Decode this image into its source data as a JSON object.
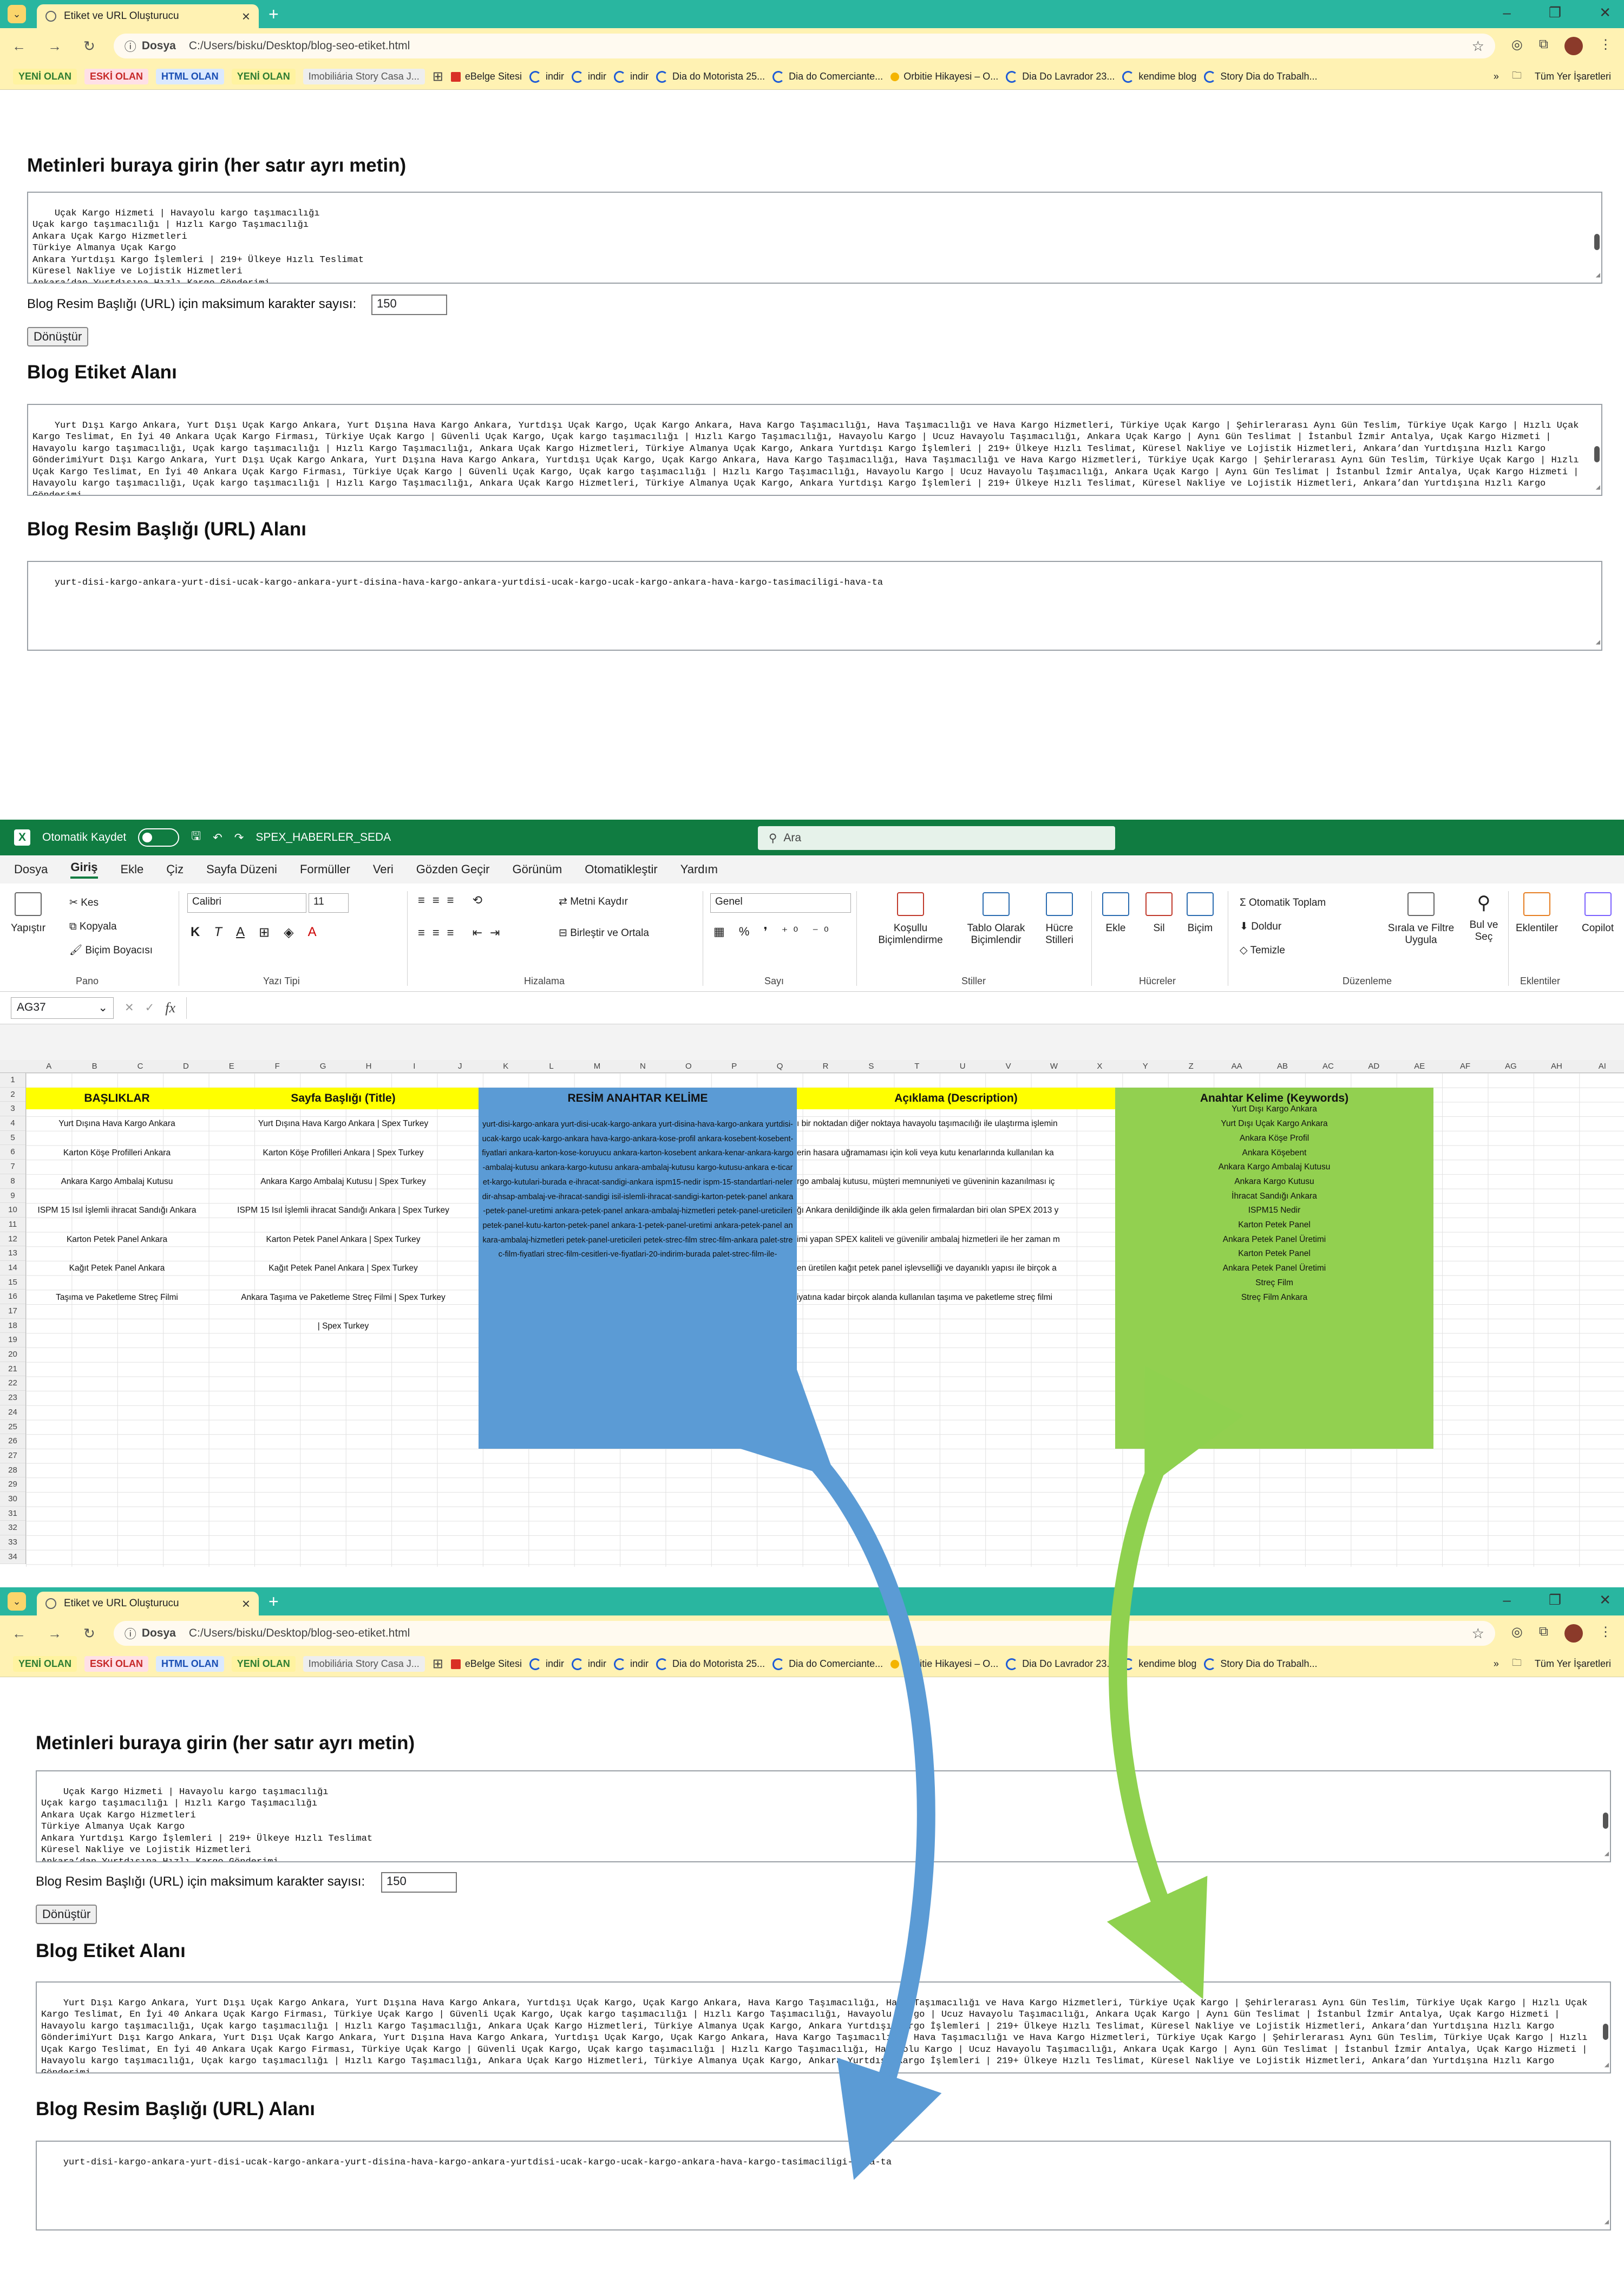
{
  "browser": {
    "tab_title": "Etiket ve URL Oluşturucu",
    "url_chip": "Dosya",
    "url": "C:/Users/bisku/Desktop/blog-seo-etiket.html",
    "bookmarks": [
      "YENİ OLAN",
      "ESKİ OLAN",
      "HTML OLAN",
      "YENİ OLAN",
      "Imobiliária Story Casa J..."
    ],
    "bookmarks_links": [
      "eBelge Sitesi",
      "indir",
      "indir",
      "indir",
      "Dia do Motorista 25...",
      "Dia do Comerciante...",
      "Orbitie Hikayesi – O...",
      "Dia Do Lavrador 23...",
      "kendime blog",
      "Story Dia do Trabalh..."
    ],
    "bookmarks_more": "»",
    "all_bookmarks": "Tüm Yer İşaretleri"
  },
  "tool": {
    "h_input": "Metinleri buraya girin (her satır ayrı metin)",
    "input_lines": "Uçak Kargo Hizmeti | Havayolu kargo taşımacılığı\nUçak kargo taşımacılığı | Hızlı Kargo Taşımacılığı\nAnkara Uçak Kargo Hizmetleri\nTürkiye Almanya Uçak Kargo\nAnkara Yurtdışı Kargo İşlemleri | 219+ Ülkeye Hızlı Teslimat\nKüresel Nakliye ve Lojistik Hizmetleri\nAnkara’dan Yurtdışına Hızlı Kargo Gönderimi",
    "max_label": "Blog Resim Başlığı (URL) için maksimum karakter sayısı:",
    "max_value": "150",
    "convert": "Dönüştür",
    "h_tags": "Blog Etiket Alanı",
    "tags_text_1": "Yurt Dışı Kargo Ankara, Yurt Dışı Uçak Kargo Ankara, Yurt Dışına Hava Kargo Ankara, Yurtdışı Uçak Kargo, Uçak Kargo Ankara, Hava Kargo Taşımacılığı, Hava Taşımacılığı ve Hava Kargo Hizmetleri, Türkiye Uçak Kargo | Şehirlerarası Aynı Gün Teslim, Türkiye Uçak Kargo | Hızlı Uçak Kargo Teslimat, En İyi 40 Ankara Uçak Kargo Firması, Türkiye Uçak Kargo | Güvenli Uçak Kargo, Uçak kargo taşımacılığı | Hızlı Kargo Taşımacılığı, Havayolu Kargo | Ucuz Havayolu Taşımacılığı, Ankara Uçak Kargo | Aynı Gün Teslimat | İstanbul İzmir Antalya, Uçak Kargo Hizmeti | Havayolu kargo taşımacılığı, Uçak kargo taşımacılığı | Hızlı Kargo Taşımacılığı, Ankara Uçak Kargo Hizmetleri, Türkiye Almanya Uçak Kargo, Ankara Yurtdışı Kargo İşlemleri | 219+ Ülkeye Hızlı Teslimat, Küresel Nakliye ve Lojistik Hizmetleri, Ankara’dan Yurtdışına Hızlı Kargo GönderimiYurt Dışı Kargo Ankara, Yurt Dışı Uçak Kargo Ankara, Yurt Dışına Hava Kargo Ankara, Yurtdışı Uçak Kargo, Uçak Kargo Ankara, Hava Kargo Taşımacılığı, Hava Taşımacılığı ve Hava Kargo Hizmetleri, Türkiye Uçak Kargo | Şehirlerarası Aynı Gün Teslim, Türkiye Uçak Kargo | Hızlı Uçak Kargo Teslimat, En İyi 40 Ankara Uçak Kargo Firması, Türkiye Uçak Kargo | Güvenli Uçak Kargo, Uçak kargo taşımacılığı | Hızlı Kargo Taşımacılığı, Havayolu Kargo | Ucuz Havayolu Taşımacılığı, Ankara Uçak Kargo | Aynı Gün Teslimat | İstanbul İzmir Antalya, Uçak Kargo Hizmeti | Havayolu kargo taşımacılığı, Uçak kargo taşımacılığı | Hızlı Kargo Taşımacılığı, Ankara Uçak Kargo Hizmetleri, Türkiye Almanya Uçak Kargo, Ankara Yurtdışı Kargo İşlemleri | 219+ Ülkeye Hızlı Teslimat, Küresel Nakliye ve Lojistik Hizmetleri, Ankara’dan Yurtdışına Hızlı Kargo Gönderimi.",
    "tags_text_2": "Yurt Dışı Kargo Ankara, Yurt Dışı Uçak Kargo Ankara, Yurt Dışına Hava Kargo Ankara, Yurtdışı Uçak Kargo, Uçak Kargo Ankara, Hava Kargo Taşımacılığı, Hava Taşımacılığı ve Hava Kargo Hizmetleri, Türkiye Uçak Kargo | Şehirlerarası Aynı Gün Teslim, Türkiye Uçak Kargo | Hızlı Uçak Kargo Teslimat, En İyi 40 Ankara Uçak Kargo Firması, Türkiye Uçak Kargo | Güvenli Uçak Kargo, Uçak kargo taşımacılığı | Hızlı Kargo Taşımacılığı, Havayolu Kargo | Ucuz Havayolu Taşımacılığı, Ankara Uçak Kargo | Aynı Gün Teslimat | İstanbul İzmir Antalya, Uçak Kargo Hizmeti | Havayolu kargo taşımacılığı, Uçak kargo taşımacılığı | Hızlı Kargo Taşımacılığı, Ankara Uçak Kargo Hizmetleri, Türkiye Almanya Uçak Kargo, Ankara Yurtdışı Kargo İşlemleri | 219+ Ülkeye Hızlı Teslimat, Küresel Nakliye ve Lojistik Hizmetleri, Ankara’dan Yurtdışına Hızlı Kargo GönderimiYurt Dışı Kargo Ankara, Yurt Dışı Uçak Kargo Ankara, Yurt Dışına Hava Kargo Ankara, Yurtdışı Uçak Kargo, Uçak Kargo Ankara, Hava Kargo Taşımacılığı, Hava Taşımacılığı ve Hava Kargo Hizmetleri, Türkiye Uçak Kargo | Şehirlerarası Aynı Gün Teslim, Türkiye Uçak Kargo | Hızlı Uçak Kargo Teslimat, En İyi 40 Ankara Uçak Kargo Firması, Türkiye Uçak Kargo | Güvenli Uçak Kargo, Uçak kargo taşımacılığı | Hızlı Kargo Taşımacılığı, Havayolu Kargo | Ucuz Havayolu Taşımacılığı, Ankara Uçak Kargo | Aynı Gün Teslimat | İstanbul İzmir Antalya, Uçak Kargo Hizmeti | Havayolu kargo taşımacılığı, Uçak kargo taşımacılığı | Hızlı Kargo Taşımacılığı, Ankara Uçak Kargo Hizmetleri, Türkiye Almanya Uçak Kargo, Ankara Yurtdışı Kargo İşlemleri | 219+ Ülkeye Hızlı Teslimat, Küresel Nakliye ve Lojistik Hizmetleri, Ankara’dan Yurtdışına Hızlı Kargo Gönderimi.",
    "h_url": "Blog Resim Başlığı (URL) Alanı",
    "url_text": "yurt-disi-kargo-ankara-yurt-disi-ucak-kargo-ankara-yurt-disina-hava-kargo-ankara-yurtdisi-ucak-kargo-ucak-kargo-ankara-hava-kargo-tasimaciligi-hava-ta"
  },
  "excel": {
    "autosave": "Otomatik Kaydet",
    "filename": "SPEX_HABERLER_SEDA",
    "search": "Ara",
    "menu": [
      "Dosya",
      "Giriş",
      "Ekle",
      "Çiz",
      "Sayfa Düzeni",
      "Formüller",
      "Veri",
      "Gözden Geçir",
      "Görünüm",
      "Otomatikleştir",
      "Yardım"
    ],
    "ribbon": {
      "paste": "Yapıştır",
      "cut": "Kes",
      "copy": "Kopyala",
      "painter": "Biçim Boyacısı",
      "g_clip": "Pano",
      "font": "Calibri",
      "size": "11",
      "g_font": "Yazı Tipi",
      "bold": "K",
      "italic": "T",
      "underline": "A",
      "wrap": "Metni Kaydır",
      "merge": "Birleştir ve Ortala",
      "g_align": "Hizalama",
      "numfmt": "Genel",
      "g_num": "Sayı",
      "cond": "Koşullu Biçimlendirme",
      "table": "Tablo Olarak Biçimlendir",
      "cellstyles": "Hücre Stilleri",
      "g_styles": "Stiller",
      "insert": "Ekle",
      "delete": "Sil",
      "format": "Biçim",
      "g_cells": "Hücreler",
      "autosum": "Otomatik Toplam",
      "fill": "Doldur",
      "clear": "Temizle",
      "sort": "Sırala ve Filtre Uygula",
      "find": "Bul ve Seç",
      "g_edit": "Düzenleme",
      "addins": "Eklentiler",
      "g_addins": "Eklentiler",
      "copilot": "Copilot"
    },
    "namebox": "AG37",
    "fx": "fx",
    "columns": [
      "A",
      "B",
      "C",
      "D",
      "E",
      "F",
      "G",
      "H",
      "I",
      "J",
      "K",
      "L",
      "M",
      "N",
      "O",
      "P",
      "Q",
      "R",
      "S",
      "T",
      "U",
      "V",
      "W",
      "X",
      "Y",
      "Z",
      "AA",
      "AB",
      "AC",
      "AD",
      "AE",
      "AF",
      "AG",
      "AH",
      "AI"
    ],
    "headers": {
      "basliklar": "BAŞLIKLAR",
      "title": "Sayfa Başlığı (Title)",
      "resim": "RESİM ANAHTAR KELİME",
      "desc": "Açıklama (Description)",
      "kw": "Anahtar Kelime (Keywords)"
    },
    "basliklar": [
      "Yurt Dışına Hava Kargo Ankara",
      "Karton Köşe Profilleri Ankara",
      "Ankara Kargo Ambalaj Kutusu",
      "ISPM 15 Isıl İşlemli ihracat Sandığı Ankara",
      "Karton Petek Panel Ankara",
      "Kağıt Petek Panel Ankara",
      "Taşıma ve Paketleme Streç Filmi"
    ],
    "titles": [
      "Yurt Dışına Hava Kargo Ankara | Spex Turkey",
      "Karton Köşe Profilleri Ankara | Spex Turkey",
      "Ankara Kargo Ambalaj Kutusu | Spex Turkey",
      "ISPM 15 Isıl İşlemli ihracat Sandığı Ankara | Spex Turkey",
      "Karton Petek Panel Ankara | Spex Turkey",
      "Kağıt Petek Panel Ankara | Spex Turkey",
      "Ankara Taşıma ve Paketleme Streç Filmi | Spex Turkey",
      " | Spex Turkey"
    ],
    "resim_text": "yurt-disi-kargo-ankara yurt-disi-ucak-kargo-ankara yurt-disina-hava-kargo-ankara yurtdisi-ucak-kargo ucak-kargo-ankara hava-kargo-ankara-kose-profil ankara-kosebent-kosebent-fiyatlari ankara-karton-kose-koruyucu ankara-karton-kosebent ankara-kenar-ankara-kargo-ambalaj-kutusu ankara-kargo-kutusu ankara-ambalaj-kutusu kargo-kutusu-ankara e-ticaret-kargo-kutulari-burada e-ihracat-sandigi-ankara ispm15-nedir ispm-15-standartlari-nelerdir-ahsap-ambalaj-ve-ihracat-sandigi isil-islemli-ihracat-sandigi-karton-petek-panel ankara-petek-panel-uretimi ankara-petek-panel ankara-ambalaj-hizmetleri petek-panel-ureticileri petek-panel-kutu-karton-petek-panel ankara-1-petek-panel-uretimi ankara-petek-panel ankara-ambalaj-hizmetleri petek-panel-ureticileri petek-strec-film strec-film-ankara palet-strec-film-fiyatlari strec-film-cesitleri-ve-fiyatlari-20-indirim-burada palet-strec-film-ile-",
    "desc": [
      "ı bir noktadan diğer noktaya havayolu taşımacılığı ile ulaştırma işlemin",
      "erin hasara uğramaması için koli veya kutu kenarlarında kullanılan ka",
      "rgo ambalaj kutusu, müşteri memnuniyeti ve güveninin kazanılması iç",
      "ğı Ankara denildiğinde ilk akla gelen firmalardan biri olan SPEX 2013 y",
      "imi yapan SPEX kaliteli ve güvenilir ambalaj hizmetleri ile her zaman m",
      "en üretilen kağıt petek panel işlevselliği ve dayanıklı yapısı ile birçok a",
      "iyatına kadar birçok alanda kullanılan taşıma ve paketleme streç filmi"
    ],
    "keywords": [
      "Yurt Dışı Kargo Ankara",
      "Yurt Dışı Uçak Kargo Ankara",
      "Ankara Köşe Profil",
      "Ankara Köşebent",
      "Ankara Kargo Ambalaj Kutusu",
      "Ankara Kargo Kutusu",
      "İhracat Sandığı Ankara",
      "ISPM15 Nedir",
      "Karton Petek Panel",
      "Ankara Petek Panel Üretimi",
      "Karton Petek Panel",
      "Ankara Petek Panel Üretimi",
      "Streç Film",
      "Streç Film Ankara"
    ]
  },
  "colors": {
    "tabstrip": "#29b6a0",
    "toolbar": "#fff2b3",
    "excel_green": "#107c41",
    "yellow": "#ffff00",
    "blue_box": "#5b9bd5",
    "green_box": "#92d050",
    "arrow_blue": "#5b9bd5",
    "arrow_green": "#8fd14f"
  },
  "icons": [
    "chevron-down-icon",
    "back-icon",
    "forward-icon",
    "reload-icon",
    "star-icon",
    "extension-icon",
    "avatar",
    "grid-icon",
    "folder-icon",
    "excel-logo-icon",
    "save-icon",
    "undo-icon",
    "redo-icon",
    "search-icon",
    "fx-icon"
  ]
}
